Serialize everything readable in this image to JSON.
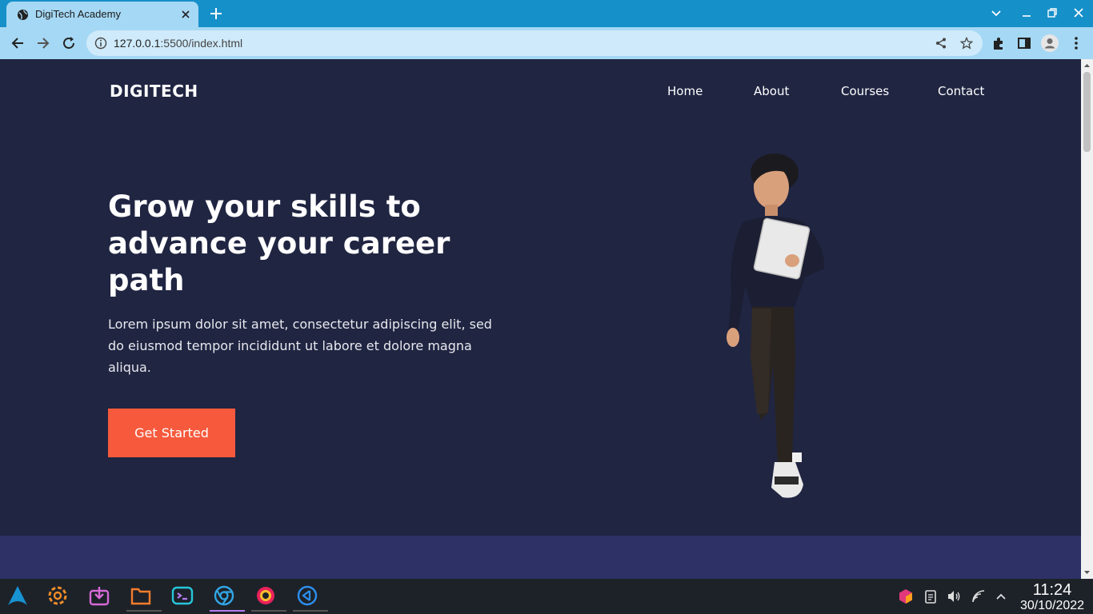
{
  "browser": {
    "tab_title": "DigiTech Academy",
    "url_host": "127.0.0.1",
    "url_path": ":5500/index.html",
    "accent": "#1690c9"
  },
  "site": {
    "logo": "DIGITECH",
    "nav": [
      "Home",
      "About",
      "Courses",
      "Contact"
    ],
    "headline": "Grow your skills to advance your career path",
    "lead": "Lorem ipsum dolor sit amet, consectetur adipiscing elit, sed do eiusmod tempor incididunt ut labore et dolore magna aliqua.",
    "cta": "Get Started",
    "colors": {
      "background": "#202542",
      "cta": "#f6593c",
      "strip": "#2e3166"
    }
  },
  "taskbar": {
    "apps": [
      "launcher-icon",
      "settings-icon",
      "software-store-icon",
      "file-manager-icon",
      "terminal-icon",
      "chromium-icon",
      "firefox-icon",
      "vscode-icon"
    ],
    "time": "11:24",
    "date": "30/10/2022"
  }
}
